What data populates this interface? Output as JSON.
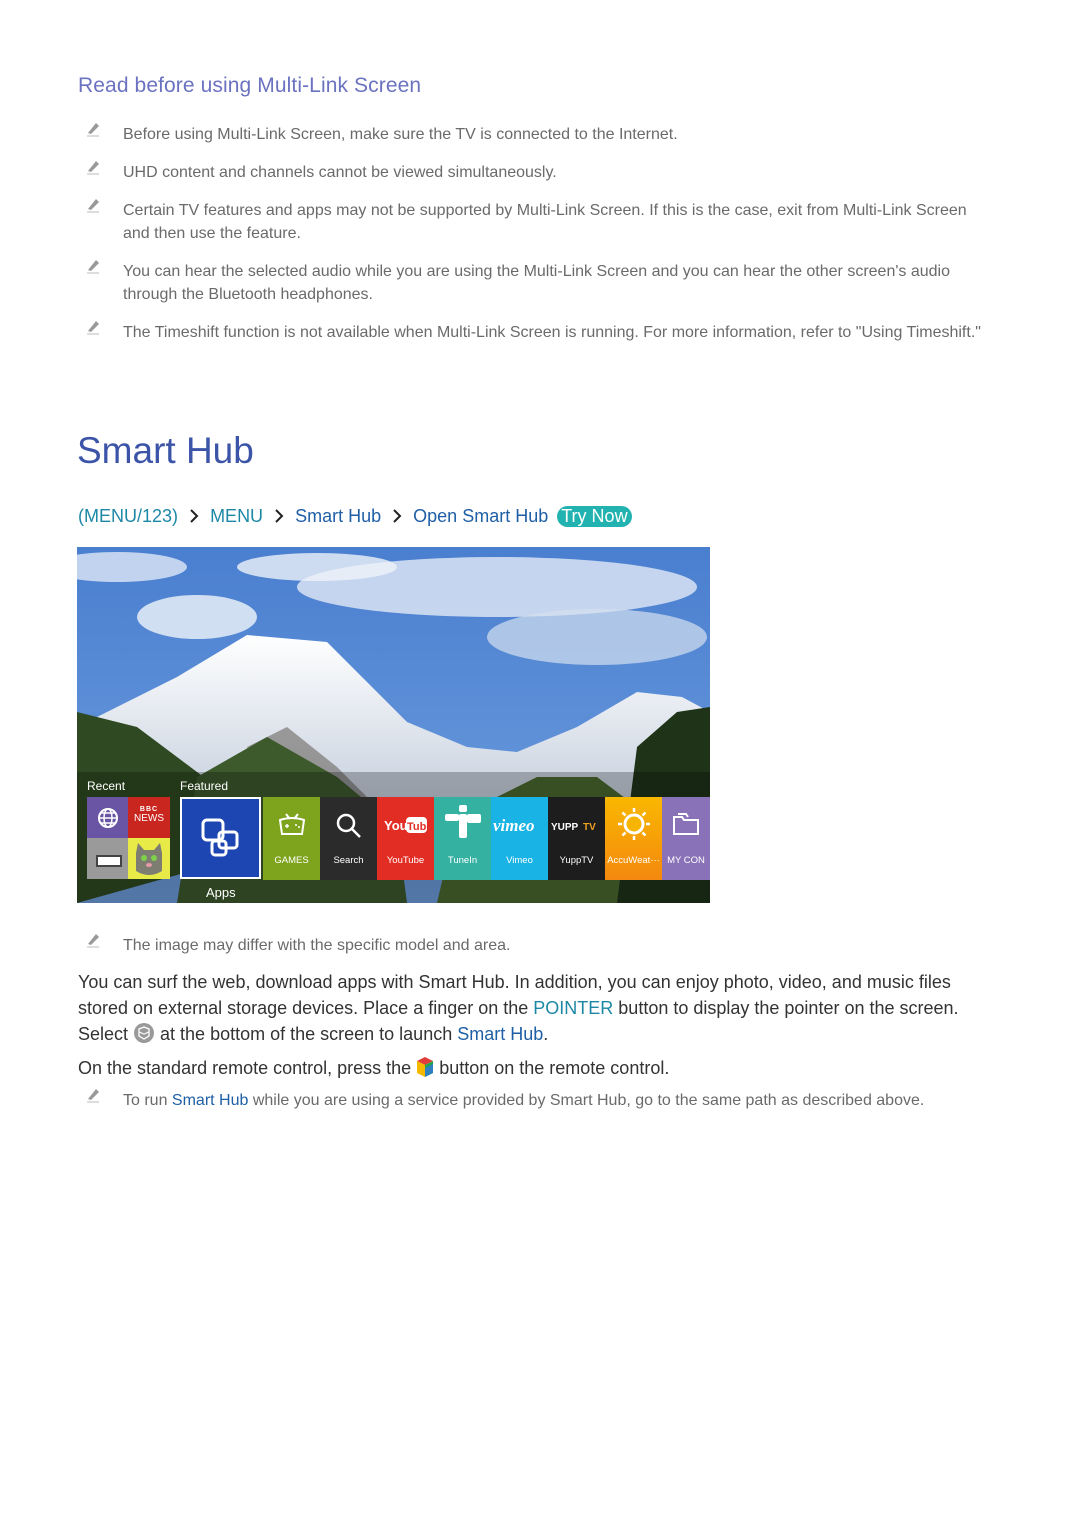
{
  "section": {
    "title": "Read before using Multi-Link Screen",
    "notes": [
      "Before using Multi-Link Screen, make sure the TV is connected to the Internet.",
      "UHD content and channels cannot be viewed simultaneously.",
      "Certain TV features and apps may not be supported by Multi-Link Screen. If this is the case, exit from Multi-Link Screen and then use the feature.",
      "You can hear the selected audio while you are using the Multi-Link Screen and you can hear the other screen's audio through the Bluetooth headphones.",
      "The Timeshift function is not available when Multi-Link Screen is running. For more information, refer to \"Using Timeshift.\""
    ]
  },
  "heading": "Smart Hub",
  "breadcrumb": {
    "items": [
      "(MENU/123)",
      "MENU",
      "Smart Hub",
      "Open Smart Hub"
    ],
    "try_now": "Try Now"
  },
  "screenshot": {
    "recent_label": "Recent",
    "featured_label": "Featured",
    "apps_label": "Apps",
    "bbc_top": "BBC",
    "bbc_bottom": "NEWS",
    "tiles": [
      {
        "label": "GAMES",
        "color": "#7ea31c",
        "icon": "gamepad-icon"
      },
      {
        "label": "Search",
        "color": "#2b2b2b",
        "icon": "search-icon"
      },
      {
        "label": "YouTube",
        "color": "#e22d25",
        "icon": "youtube-logo"
      },
      {
        "label": "TuneIn",
        "color": "#35b1a2",
        "icon": "tunein-logo"
      },
      {
        "label": "Vimeo",
        "color": "#19b3e6",
        "icon": "vimeo-logo"
      },
      {
        "label": "YuppTV",
        "color": "#1d1d1d",
        "icon": "yupptv-logo"
      },
      {
        "label": "AccuWeat···",
        "color": "#f79a12",
        "icon": "sun-icon"
      },
      {
        "label": "MY CON",
        "color": "#8a72b8",
        "icon": "folder-icon"
      }
    ],
    "logo_texts": {
      "youtube_a": "You",
      "youtube_b": "Tube",
      "vimeo": "vimeo",
      "yupp_a": "YUPP",
      "yupp_b": "TV"
    }
  },
  "image_note": "The image may differ with the specific model and area.",
  "body": {
    "p1_a": "You can surf the web, download apps with Smart Hub. In addition, you can enjoy photo, video, and music files stored on external storage devices. Place a finger on the ",
    "p1_pointer": "POINTER",
    "p1_b": " button to display the pointer on the screen. Select ",
    "p1_c": " at the bottom of the screen to launch ",
    "p1_link": "Smart Hub",
    "p1_end": ".",
    "p2_a": "On the standard remote control, press the ",
    "p2_b": " button on the remote control."
  },
  "final_note": {
    "a": "To run ",
    "link": "Smart Hub",
    "b": " while you are using a service provided by Smart Hub, go to the same path as described above."
  },
  "colors": {
    "section_title": "#6b73c1",
    "heading": "#3c54a8",
    "link_blue": "#1f5fa6",
    "link_teal": "#1d88a6",
    "try_now_bg": "#22b3b0"
  }
}
